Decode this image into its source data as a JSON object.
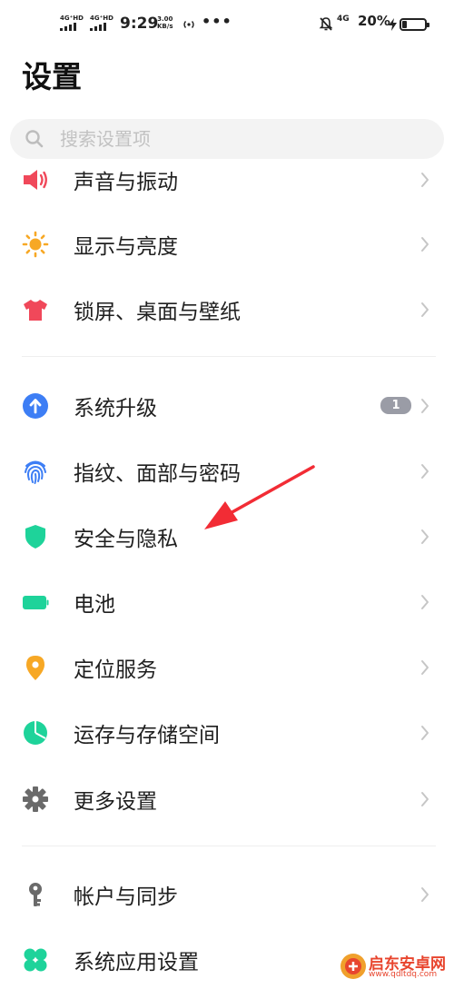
{
  "status_bar": {
    "network1": "4G⁺HD",
    "network2": "4G⁺HD",
    "time": "9:29",
    "speed_value": "3.00",
    "speed_unit": "KB/s",
    "more": "•••",
    "net3": "4G",
    "battery_text": "20%",
    "battery_level": 0.2
  },
  "page": {
    "title": "设置"
  },
  "search": {
    "placeholder": "搜索设置项"
  },
  "items": [
    {
      "label": "声音与振动",
      "icon": "speaker-icon",
      "color": "#f0485a"
    },
    {
      "label": "显示与亮度",
      "icon": "sun-icon",
      "color": "#f7a825"
    },
    {
      "label": "锁屏、桌面与壁纸",
      "icon": "tshirt-icon",
      "color": "#f0485a"
    },
    {
      "label": "系统升级",
      "icon": "upgrade-arrow-icon",
      "color": "#3d7ef5",
      "badge": "1"
    },
    {
      "label": "指纹、面部与密码",
      "icon": "fingerprint-icon",
      "color": "#3d7ef5"
    },
    {
      "label": "安全与隐私",
      "icon": "shield-icon",
      "color": "#1ed39a"
    },
    {
      "label": "电池",
      "icon": "battery-icon",
      "color": "#1ed39a"
    },
    {
      "label": "定位服务",
      "icon": "location-pin-icon",
      "color": "#f7a825"
    },
    {
      "label": "运存与存储空间",
      "icon": "pie-chart-icon",
      "color": "#1ed39a"
    },
    {
      "label": "更多设置",
      "icon": "gear-icon",
      "color": "#6a6a6a"
    },
    {
      "label": "帐户与同步",
      "icon": "key-icon",
      "color": "#6a6a6a"
    },
    {
      "label": "系统应用设置",
      "icon": "clover-icon",
      "color": "#1ed39a"
    }
  ],
  "watermark": {
    "name": "启东安卓网",
    "url": "www.qdltdq.com"
  },
  "colors": {
    "annotation_arrow": "#f22c35",
    "chevron": "#c6c6c6",
    "badge": "#9a9ca6"
  }
}
